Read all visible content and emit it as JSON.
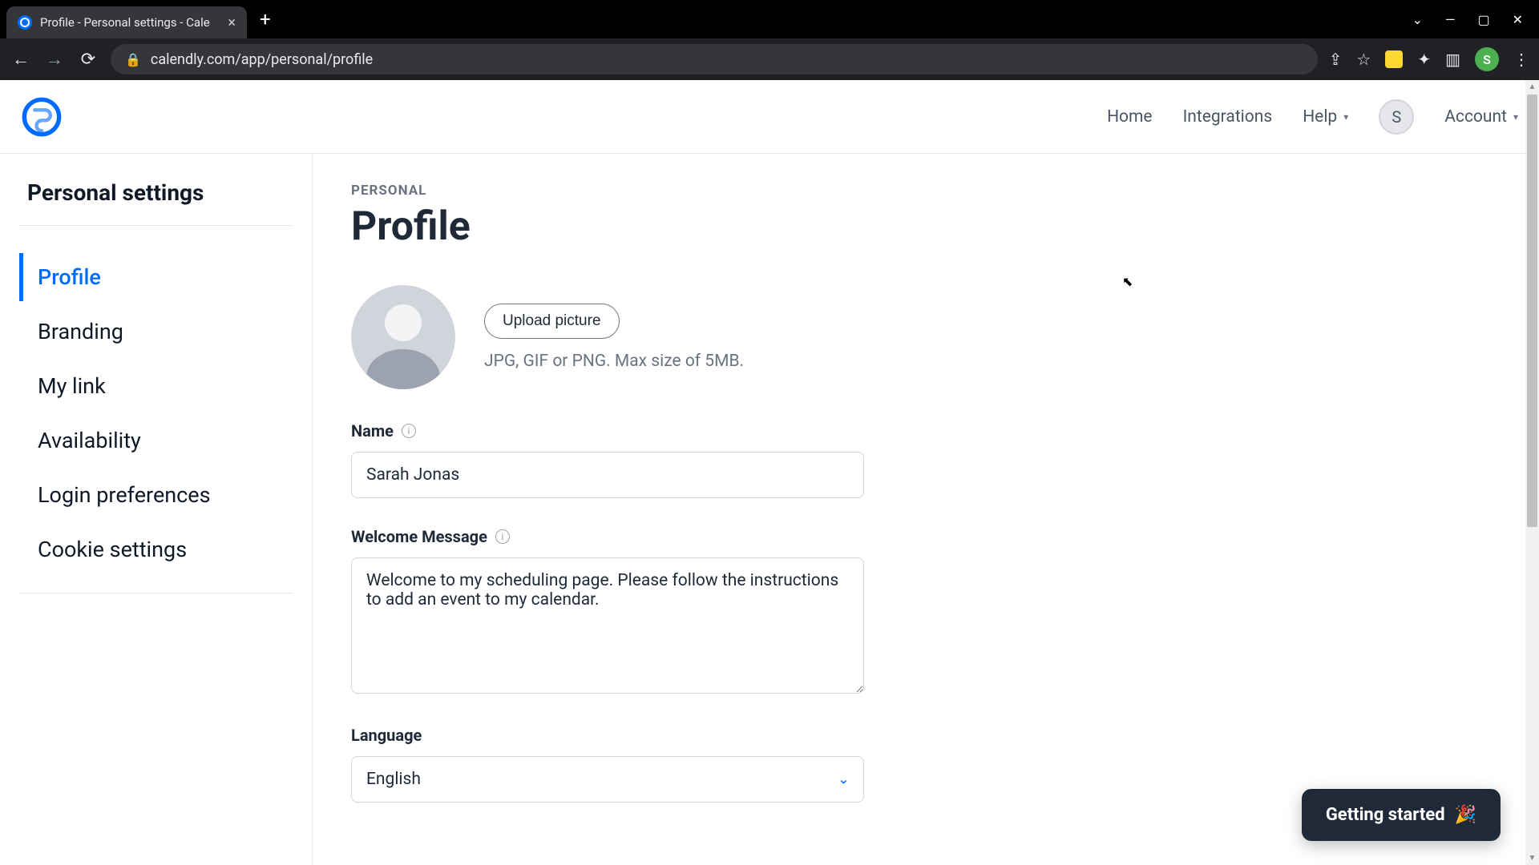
{
  "browser": {
    "tab_title": "Profile - Personal settings - Cale",
    "url": "calendly.com/app/personal/profile"
  },
  "header": {
    "nav": {
      "home": "Home",
      "integrations": "Integrations",
      "help": "Help",
      "account": "Account"
    },
    "user_initial": "S"
  },
  "sidebar": {
    "title": "Personal settings",
    "items": [
      "Profile",
      "Branding",
      "My link",
      "Availability",
      "Login preferences",
      "Cookie settings"
    ],
    "active_index": 0
  },
  "main": {
    "breadcrumb": "PERSONAL",
    "title": "Profile",
    "upload_button": "Upload picture",
    "upload_hint": "JPG, GIF or PNG. Max size of 5MB.",
    "fields": {
      "name_label": "Name",
      "name_value": "Sarah Jonas",
      "welcome_label": "Welcome Message",
      "welcome_value": "Welcome to my scheduling page. Please follow the instructions to add an event to my calendar.",
      "language_label": "Language",
      "language_value": "English"
    }
  },
  "popup": {
    "getting_started": "Getting started",
    "emoji": "🎉"
  }
}
